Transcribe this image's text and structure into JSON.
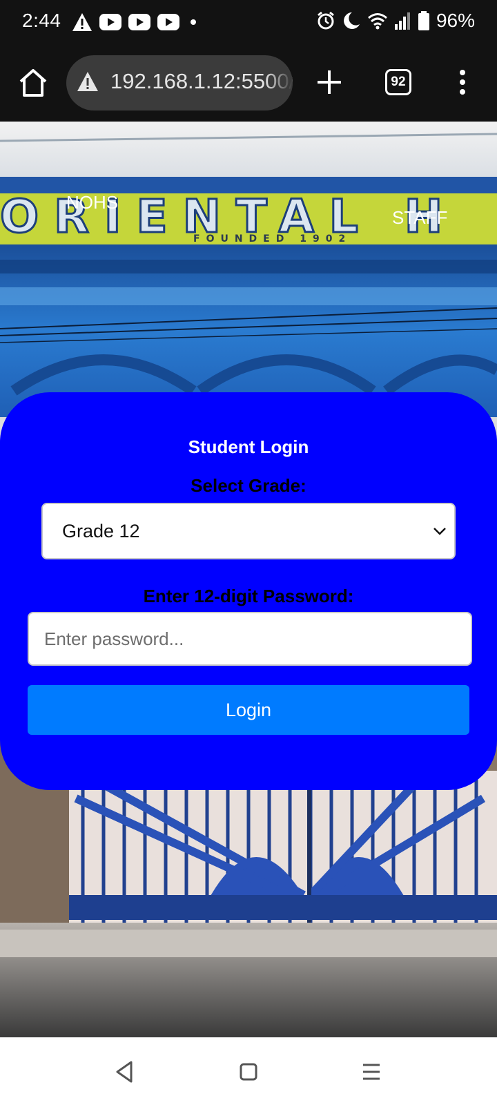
{
  "status_bar": {
    "time": "2:44",
    "battery": "96%",
    "left_icons": [
      "warning-icon",
      "youtube-icon",
      "youtube-icon",
      "youtube-icon",
      "dot-icon"
    ],
    "right_icons": [
      "alarm-icon",
      "moon-icon",
      "wifi-icon",
      "signal-icon",
      "battery-icon"
    ]
  },
  "browser": {
    "url": "192.168.1.12:5500/",
    "tab_count": "92"
  },
  "page": {
    "nav_left": "NOHS",
    "nav_right": "STAFF"
  },
  "login": {
    "title": "Student Login",
    "grade_label": "Select Grade:",
    "grade_value": "Grade 12",
    "password_label": "Enter 12-digit Password:",
    "password_placeholder": "Enter password...",
    "login_label": "Login"
  },
  "colors": {
    "card": "#0000ff",
    "button": "#007bff"
  }
}
